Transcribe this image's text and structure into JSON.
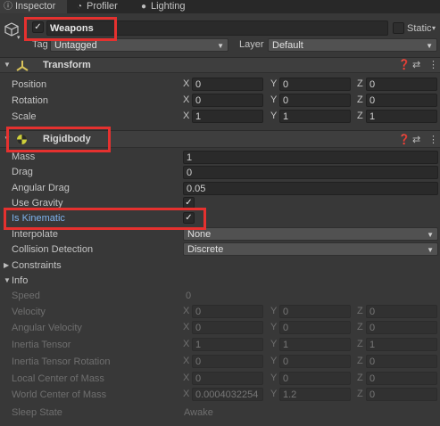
{
  "tabs": [
    {
      "label": "Inspector",
      "icon": "info-icon"
    },
    {
      "label": "Profiler",
      "icon": "profiler-icon"
    },
    {
      "label": "Lighting",
      "icon": "lightbulb-icon"
    }
  ],
  "gameobject": {
    "name": "Weapons",
    "active": true,
    "static_label": "Static",
    "tag_label": "Tag",
    "tag_value": "Untagged",
    "layer_label": "Layer",
    "layer_value": "Default"
  },
  "transform": {
    "title": "Transform",
    "rows": [
      {
        "label": "Position",
        "x": "0",
        "y": "0",
        "z": "0"
      },
      {
        "label": "Rotation",
        "x": "0",
        "y": "0",
        "z": "0"
      },
      {
        "label": "Scale",
        "x": "1",
        "y": "1",
        "z": "1"
      }
    ]
  },
  "axes": {
    "x": "X",
    "y": "Y",
    "z": "Z"
  },
  "rigidbody": {
    "title": "Rigidbody",
    "mass_label": "Mass",
    "mass": "1",
    "drag_label": "Drag",
    "drag": "0",
    "angular_drag_label": "Angular Drag",
    "angular_drag": "0.05",
    "use_gravity_label": "Use Gravity",
    "use_gravity": true,
    "is_kinematic_label": "Is Kinematic",
    "is_kinematic": true,
    "interpolate_label": "Interpolate",
    "interpolate": "None",
    "collision_label": "Collision Detection",
    "collision": "Discrete",
    "constraints_label": "Constraints",
    "info_label": "Info",
    "speed_label": "Speed",
    "speed": "0",
    "vector_rows": [
      {
        "label": "Velocity",
        "x": "0",
        "y": "0",
        "z": "0"
      },
      {
        "label": "Angular Velocity",
        "x": "0",
        "y": "0",
        "z": "0"
      },
      {
        "label": "Inertia Tensor",
        "x": "1",
        "y": "1",
        "z": "1"
      },
      {
        "label": "Inertia Tensor Rotation",
        "x": "0",
        "y": "0",
        "z": "0"
      },
      {
        "label": "Local Center of Mass",
        "x": "0",
        "y": "0",
        "z": "0"
      },
      {
        "label": "World Center of Mass",
        "x": "0.0004032254",
        "y": "1.2",
        "z": "0"
      }
    ],
    "sleep_label": "Sleep State",
    "sleep": "Awake"
  },
  "check_glyph": "✓",
  "colors": {
    "highlight": "#e5312f",
    "link_label": "#7eb3ef",
    "panel": "#383838"
  }
}
